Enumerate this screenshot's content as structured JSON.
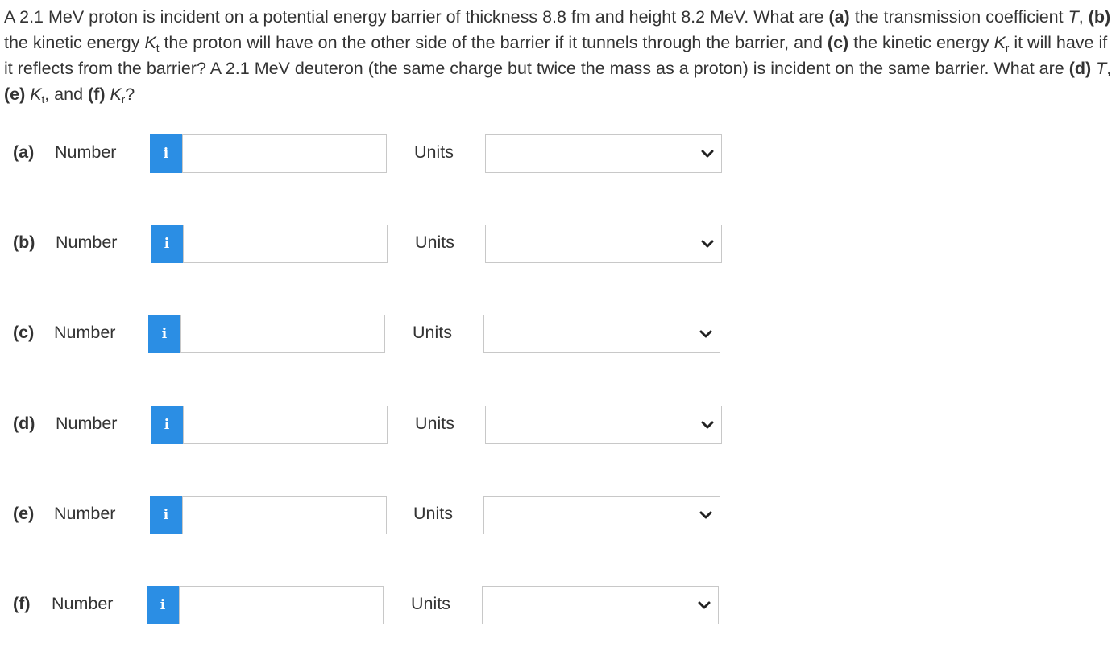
{
  "question": {
    "s1": "A 2.1 MeV proton is incident on a potential energy barrier of thickness 8.8 fm and height 8.2 MeV. What are ",
    "a_tag": "(a)",
    "s2": " the transmission coefficient ",
    "T1": "T",
    "s3": ", ",
    "b_tag": "(b)",
    "s4": " the kinetic energy ",
    "K1": "K",
    "t1": "t",
    "s5": " the proton will have on the other side of the barrier if it tunnels through the barrier, and ",
    "c_tag": "(c)",
    "s6": " the kinetic energy ",
    "K2": "K",
    "r1": "r",
    "s7": " it will have if it reflects from the barrier? A 2.1 MeV deuteron (the same charge but twice the mass as a proton) is incident on the same barrier. What are ",
    "d_tag": "(d)",
    "s8": " ",
    "T2": "T",
    "s9": ", ",
    "e_tag": "(e)",
    "s10": " ",
    "K3": "K",
    "t2": "t",
    "s11": ", and ",
    "f_tag": "(f)",
    "s12": " ",
    "K4": "K",
    "r2": "r",
    "s13": "?"
  },
  "info_icon": "i",
  "number_label": "Number",
  "units_label": "Units",
  "parts": [
    {
      "label": "(a)",
      "number_value": "",
      "units_value": ""
    },
    {
      "label": "(b)",
      "number_value": "",
      "units_value": ""
    },
    {
      "label": "(c)",
      "number_value": "",
      "units_value": ""
    },
    {
      "label": "(d)",
      "number_value": "",
      "units_value": ""
    },
    {
      "label": "(e)",
      "number_value": "",
      "units_value": ""
    },
    {
      "label": "(f)",
      "number_value": "",
      "units_value": ""
    }
  ],
  "colors": {
    "info_button": "#2b8ee4",
    "input_border": "#c8c8c8",
    "text": "#333333"
  }
}
